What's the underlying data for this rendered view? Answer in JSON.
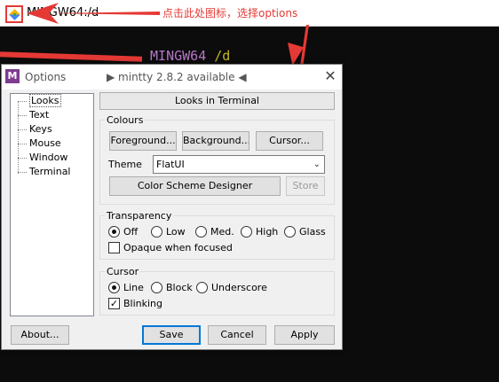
{
  "window": {
    "title": "MINGW64:/d",
    "annotation": "点击此处图标，选择options"
  },
  "terminal": {
    "host": "MINGW64",
    "path": "/d"
  },
  "dialog": {
    "title": "Options",
    "update_notice": "▶ mintty 2.8.2 available ◀",
    "close": "✕",
    "tree": [
      "Looks",
      "Text",
      "Keys",
      "Mouse",
      "Window",
      "Terminal"
    ],
    "selected": "Looks",
    "page_title": "Looks in Terminal",
    "colours": {
      "label": "Colours",
      "foreground": "Foreground...",
      "background": "Background...",
      "cursor": "Cursor...",
      "theme_label": "Theme",
      "theme_value": "FlatUI",
      "designer": "Color Scheme Designer",
      "store": "Store"
    },
    "transparency": {
      "label": "Transparency",
      "options": [
        "Off",
        "Low",
        "Med.",
        "High",
        "Glass"
      ],
      "selected": "Off",
      "opaque_label": "Opaque when focused",
      "opaque_checked": false
    },
    "cursor": {
      "label": "Cursor",
      "options": [
        "Line",
        "Block",
        "Underscore"
      ],
      "selected": "Line",
      "blinking_label": "Blinking",
      "blinking_checked": true
    },
    "buttons": {
      "about": "About...",
      "save": "Save",
      "cancel": "Cancel",
      "apply": "Apply"
    }
  },
  "colors": {
    "annotation_red": "#e53935",
    "terminal_bg": "#0c0c0c",
    "prompt_host": "#b678c8",
    "prompt_path": "#c8b820",
    "dialog_bg": "#f0f0f0",
    "mintty_icon": "#7d3c8f"
  }
}
